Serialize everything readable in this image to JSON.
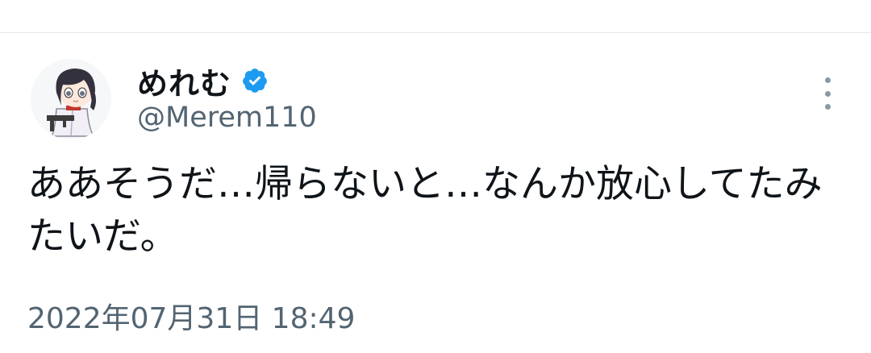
{
  "user": {
    "display_name": "めれむ",
    "handle": "@Merem110",
    "verified": true,
    "verified_color": "#1d9bf0"
  },
  "tweet": {
    "text": "ああそうだ…帰らないと…なんか放心してたみたいだ。",
    "timestamp": "2022年07月31日 18:49"
  },
  "icons": {
    "verified": "verified-badge-icon",
    "more": "more-options-icon"
  }
}
